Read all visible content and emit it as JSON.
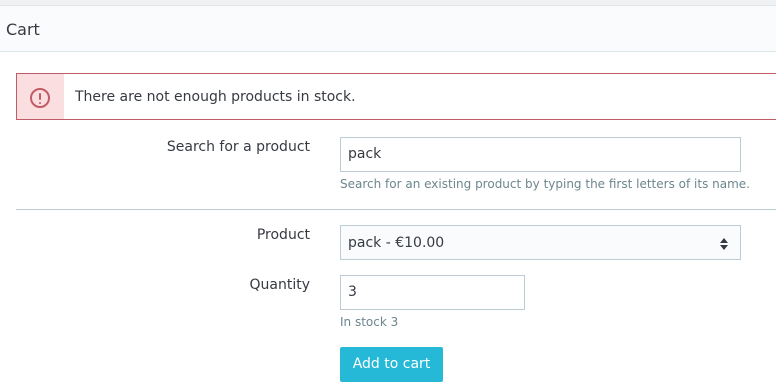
{
  "panel": {
    "title": "Cart"
  },
  "alert": {
    "icon": "error-circle-icon",
    "message": "There are not enough products in stock."
  },
  "search": {
    "label": "Search for a product",
    "value": "pack",
    "help": "Search for an existing product by typing the first letters of its name."
  },
  "product": {
    "label": "Product",
    "selected": "pack - €10.00"
  },
  "quantity": {
    "label": "Quantity",
    "value": "3",
    "stock_text": "In stock 3"
  },
  "actions": {
    "add_to_cart_label": "Add to cart"
  },
  "colors": {
    "accent": "#25b9d7",
    "danger": "#c05c67",
    "danger_bg": "#fbdedf",
    "help_text": "#6c868e",
    "border": "#bbcdd2"
  }
}
